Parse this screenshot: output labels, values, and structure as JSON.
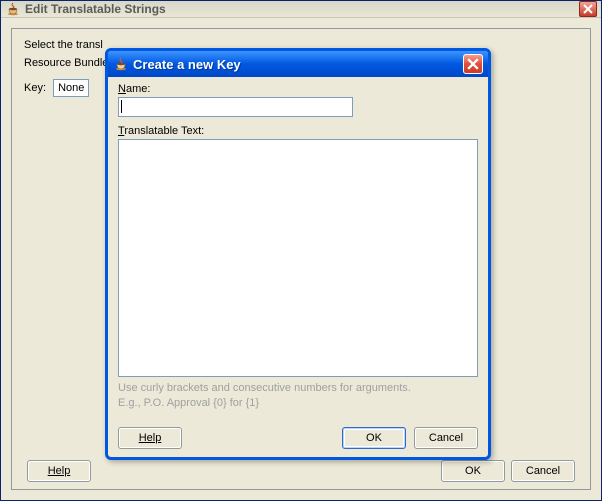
{
  "outer": {
    "title": "Edit Translatable Strings",
    "instruction_partial": "Select the transl",
    "resource_bundle_partial": "Resource Bundle",
    "key_label": "Key:",
    "key_value": "None",
    "help": "Help",
    "ok": "OK",
    "cancel": "Cancel"
  },
  "modal": {
    "title": "Create a new Key",
    "name_label_prefix": "N",
    "name_label_rest": "ame:",
    "name_value": "",
    "text_label_prefix": "T",
    "text_label_rest": "ranslatable Text:",
    "text_value": "",
    "hint_line1": "Use curly brackets and consecutive numbers for arguments.",
    "hint_line2": "E.g., P.O. Approval {0} for {1}",
    "help": "Help",
    "ok": "OK",
    "cancel": "Cancel"
  }
}
